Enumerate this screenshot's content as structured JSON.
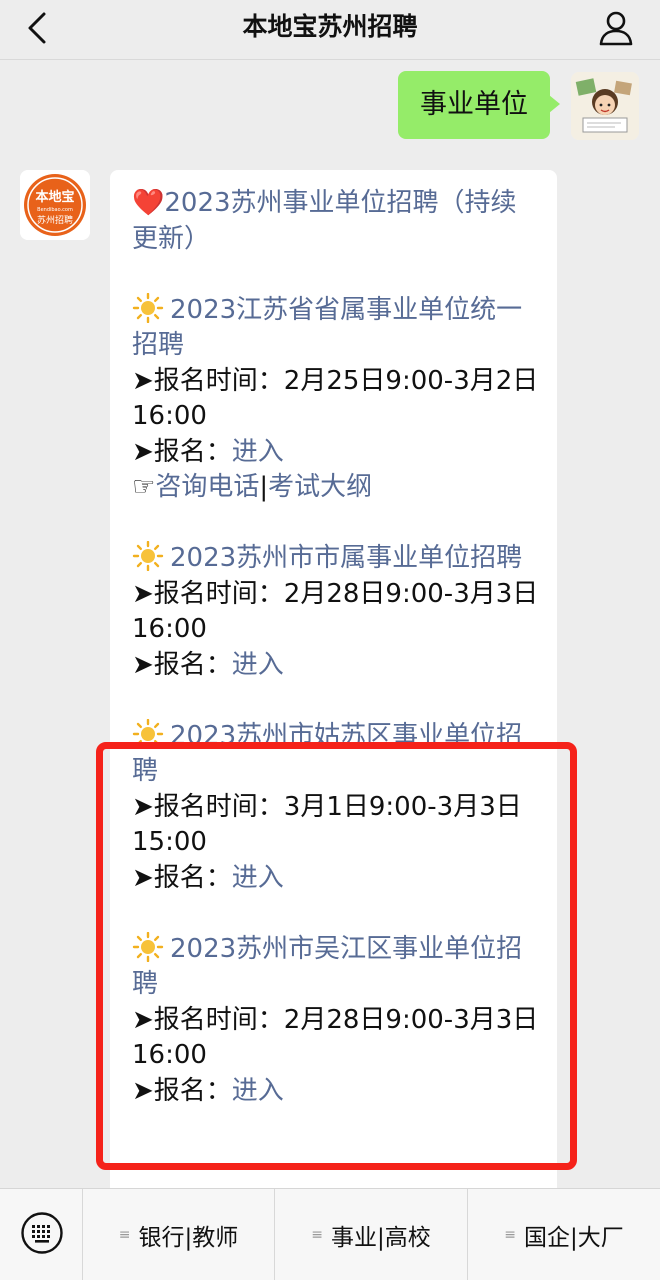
{
  "header": {
    "title": "本地宝苏州招聘",
    "back_icon": "chevron-left-icon",
    "profile_icon": "person-icon"
  },
  "outgoing": {
    "text": "事业单位"
  },
  "bot_avatar": {
    "logo_text": "本地宝",
    "domain_text": "Bendibao.com",
    "sub_text": "苏州招聘"
  },
  "reply": {
    "headline": {
      "emoji": "❤️",
      "text": "2023苏州事业单位招聘（持续更新）"
    },
    "items": [
      {
        "title": "2023江苏省省属事业单位统一招聘",
        "time_label": "➤报名时间：",
        "time_value": "2月25日9:00-3月2日16:00",
        "signup_label": "➤报名：",
        "signup_link": "进入",
        "extra": {
          "pointer": "☞",
          "link1": "咨询电话",
          "sep": "|",
          "link2": "考试大纲"
        }
      },
      {
        "title": "2023苏州市市属事业单位招聘",
        "time_label": "➤报名时间：",
        "time_value": "2月28日9:00-3月3日16:00",
        "signup_label": "➤报名：",
        "signup_link": "进入"
      },
      {
        "title": "2023苏州市姑苏区事业单位招聘",
        "time_label": "➤报名时间：",
        "time_value": "3月1日9:00-3月3日15:00",
        "signup_label": "➤报名：",
        "signup_link": "进入"
      },
      {
        "title": "2023苏州市吴江区事业单位招聘",
        "time_label": "➤报名时间：",
        "time_value": "2月28日9:00-3月3日16:00",
        "signup_label": "➤报名：",
        "signup_link": "进入"
      }
    ]
  },
  "bottom_menu": {
    "keyboard_icon": "keyboard-icon",
    "menu_icon": "menu-lines-icon",
    "items": [
      "银行|教师",
      "事业|高校",
      "国企|大厂"
    ]
  },
  "colors": {
    "link": "#576b95",
    "bubble_out": "#95ec69",
    "highlight": "#f5221a",
    "brand_orange": "#e8621a"
  }
}
